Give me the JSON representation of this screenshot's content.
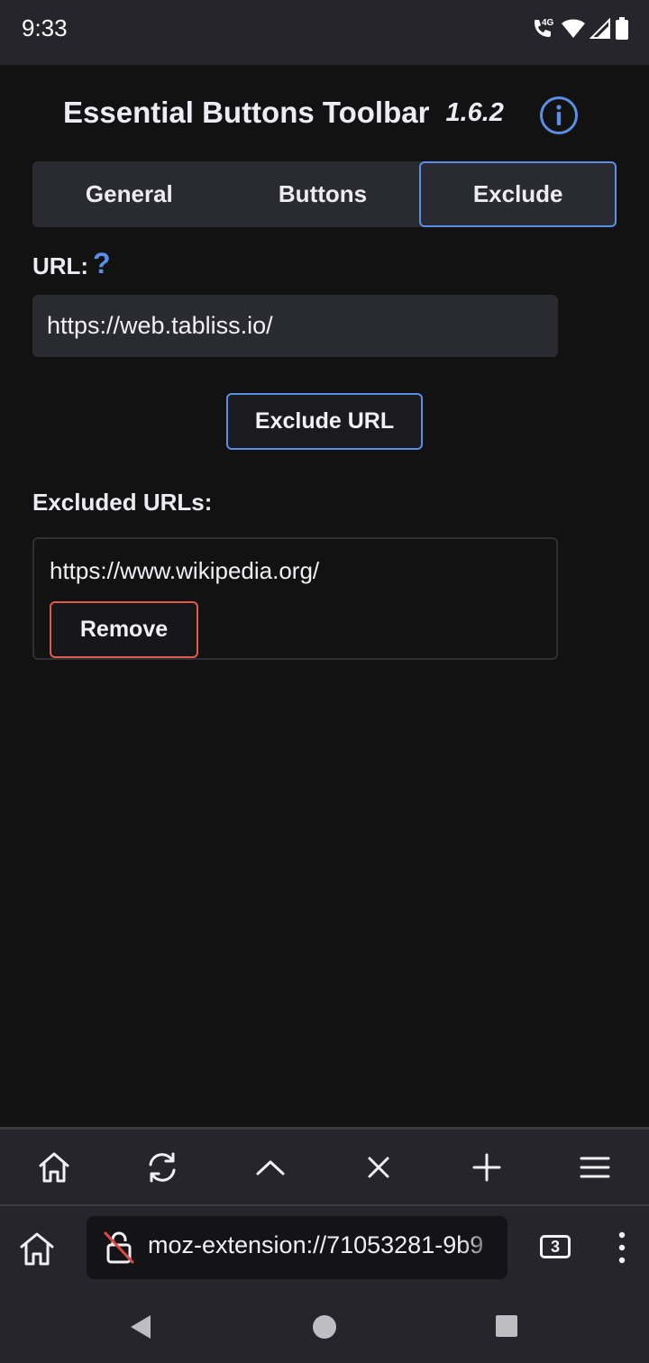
{
  "status_bar": {
    "time": "9:33",
    "network_label": "4G"
  },
  "header": {
    "title": "Essential Buttons Toolbar",
    "version": "1.6.2"
  },
  "tabs": [
    {
      "label": "General",
      "active": false
    },
    {
      "label": "Buttons",
      "active": false
    },
    {
      "label": "Exclude",
      "active": true
    }
  ],
  "url_section": {
    "label": "URL:",
    "help": "?",
    "value": "https://web.tabliss.io/",
    "exclude_button": "Exclude URL"
  },
  "excluded_section": {
    "label": "Excluded URLs:",
    "items": [
      {
        "url": "https://www.wikipedia.org/",
        "remove_label": "Remove"
      }
    ]
  },
  "toolbar": {
    "buttons": [
      "home-icon",
      "refresh-icon",
      "chevron-up-icon",
      "close-icon",
      "plus-icon",
      "menu-icon"
    ]
  },
  "address_bar": {
    "url": "moz-extension://71053281-9b9",
    "tab_count": "3"
  },
  "colors": {
    "accent": "#5b8ee6",
    "danger": "#e05a4a",
    "background": "#121212",
    "surface": "#2a2a31",
    "bar": "#25252b"
  }
}
